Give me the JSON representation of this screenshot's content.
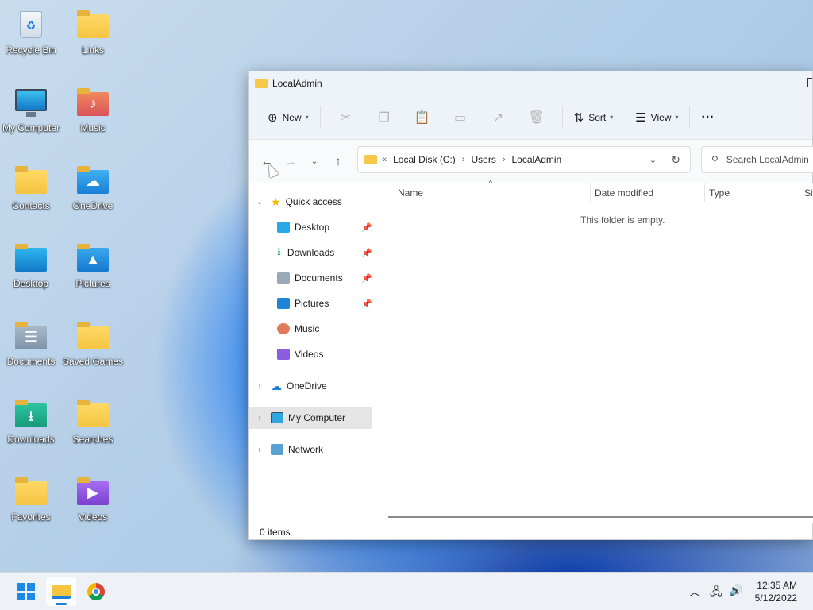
{
  "desktop": {
    "icons": [
      {
        "label": "Recycle Bin"
      },
      {
        "label": "Links"
      },
      {
        "label": "My Computer"
      },
      {
        "label": "Music"
      },
      {
        "label": "Contacts"
      },
      {
        "label": "OneDrive"
      },
      {
        "label": "Desktop"
      },
      {
        "label": "Pictures"
      },
      {
        "label": "Documents"
      },
      {
        "label": "Saved Games"
      },
      {
        "label": "Downloads"
      },
      {
        "label": "Searches"
      },
      {
        "label": "Favorites"
      },
      {
        "label": "Videos"
      }
    ]
  },
  "window": {
    "title": "LocalAdmin",
    "minimize_glyph": "—",
    "toolbar": {
      "new": "New",
      "sort": "Sort",
      "view": "View",
      "more": "···"
    },
    "address": {
      "prefix": "«",
      "seg1": "Local Disk (C:)",
      "seg2": "Users",
      "seg3": "LocalAdmin"
    },
    "search_placeholder": "Search LocalAdmin",
    "nav": {
      "quick_access": "Quick access",
      "desktop": "Desktop",
      "downloads": "Downloads",
      "documents": "Documents",
      "pictures": "Pictures",
      "music": "Music",
      "videos": "Videos",
      "onedrive": "OneDrive",
      "my_computer": "My Computer",
      "network": "Network"
    },
    "columns": {
      "name": "Name",
      "date": "Date modified",
      "type": "Type",
      "size": "Si"
    },
    "empty_message": "This folder is empty.",
    "status": "0 items"
  },
  "taskbar": {
    "time": "12:35 AM",
    "date": "5/12/2022"
  }
}
